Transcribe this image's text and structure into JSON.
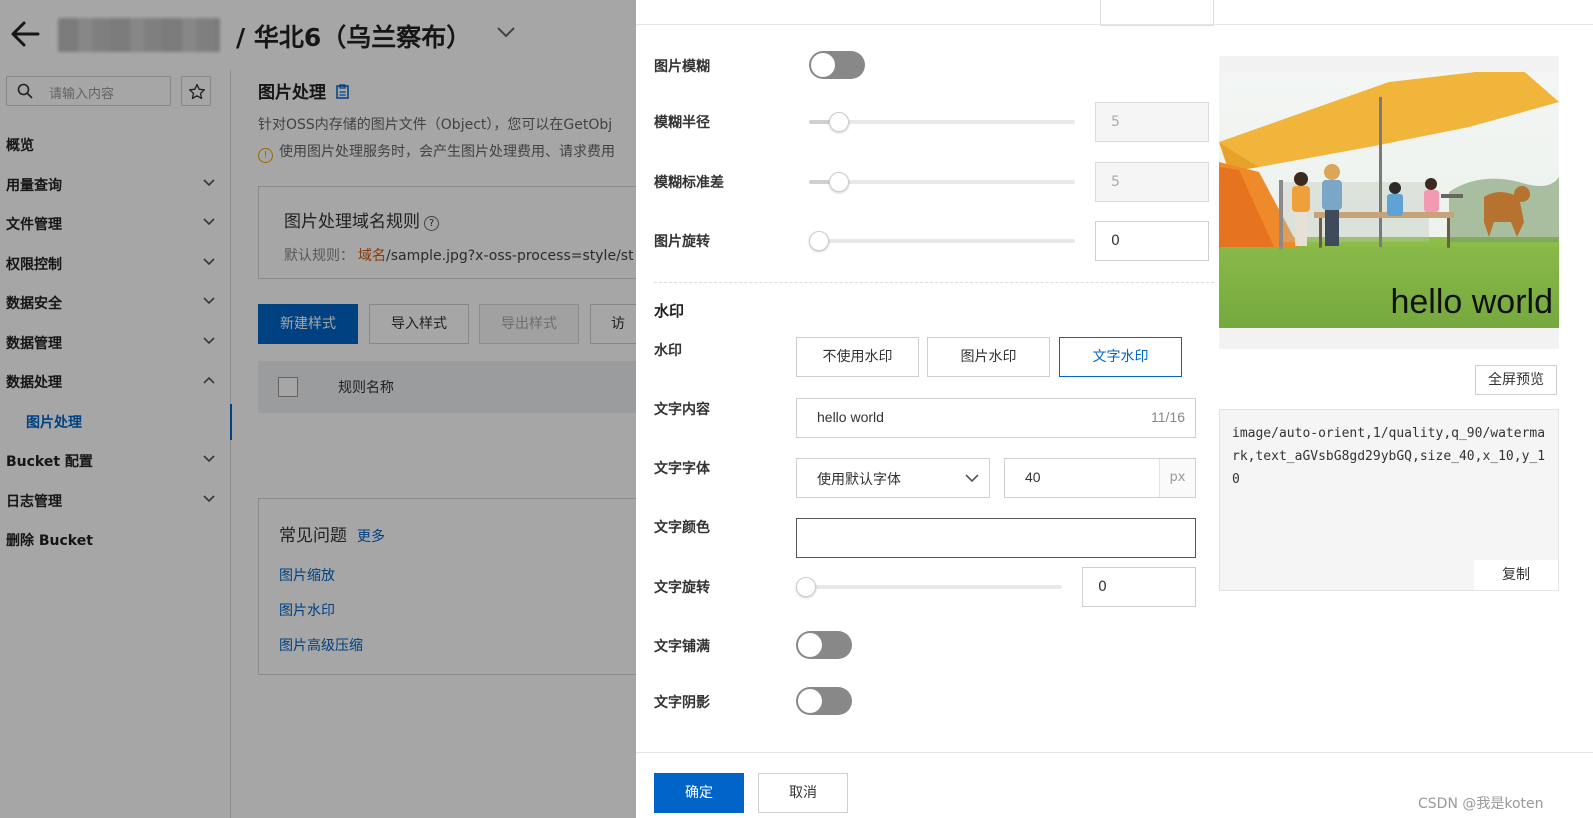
{
  "header": {
    "region_title": "/ 华北6（乌兰察布）"
  },
  "sidebar": {
    "search_placeholder": "请输入内容",
    "items": [
      {
        "label": "概览",
        "chevron": "none"
      },
      {
        "label": "用量查询",
        "chevron": "down"
      },
      {
        "label": "文件管理",
        "chevron": "down"
      },
      {
        "label": "权限控制",
        "chevron": "down"
      },
      {
        "label": "数据安全",
        "chevron": "down"
      },
      {
        "label": "数据管理",
        "chevron": "down"
      },
      {
        "label": "数据处理",
        "chevron": "up"
      },
      {
        "label": "图片处理",
        "chevron": "none",
        "sub": true,
        "active": true
      },
      {
        "label": "Bucket 配置",
        "chevron": "down"
      },
      {
        "label": "日志管理",
        "chevron": "down"
      },
      {
        "label": "删除 Bucket",
        "chevron": "none"
      }
    ]
  },
  "main": {
    "title": "图片处理",
    "description": "针对OSS内存储的图片文件（Object），您可以在GetObj",
    "warning": "使用图片处理服务时，会产生图片处理费用、请求费用",
    "rule_card": {
      "title": "图片处理域名规则",
      "rule_prefix": "默认规则：",
      "rule_domain": "域名",
      "rule_path": "/sample.jpg?x-oss-process=style/st"
    },
    "buttons": {
      "new_style": "新建样式",
      "import_style": "导入样式",
      "export_style": "导出样式",
      "access": "访"
    },
    "table": {
      "column_name": "规则名称"
    },
    "faq": {
      "title": "常见问题",
      "more": "更多",
      "links": [
        "图片缩放",
        "图片水印",
        "图片高级压缩"
      ]
    }
  },
  "drawer": {
    "blur": {
      "label": "图片模糊",
      "enabled": false
    },
    "blur_radius": {
      "label": "模糊半径",
      "value": "5",
      "min": 1,
      "max": 50,
      "level": 5
    },
    "blur_sigma": {
      "label": "模糊标准差",
      "value": "5",
      "min": 1,
      "max": 50,
      "level": 5
    },
    "rotate": {
      "label": "图片旋转",
      "value": "0",
      "min": 0,
      "max": 360,
      "level": 0
    },
    "watermark_section": "水印",
    "watermark": {
      "label": "水印",
      "options": [
        "不使用水印",
        "图片水印",
        "文字水印"
      ],
      "selected": "文字水印"
    },
    "text_content": {
      "label": "文字内容",
      "value": "hello world",
      "counter": "11/16"
    },
    "text_font": {
      "label": "文字字体",
      "font": "使用默认字体",
      "size": "40",
      "unit": "px"
    },
    "text_color": {
      "label": "文字颜色",
      "value": ""
    },
    "text_rotate": {
      "label": "文字旋转",
      "value": "0",
      "min": 0,
      "max": 360,
      "level": 0
    },
    "text_tile": {
      "label": "文字铺满",
      "enabled": false
    },
    "text_shadow": {
      "label": "文字阴影",
      "enabled": false
    },
    "preview": {
      "watermark_text": "hello world",
      "fullscreen_label": "全屏预览"
    },
    "code": {
      "value": "image/auto-orient,1/quality,q_90/watermark,text_aGVsbG8gd29ybGQ,size_40,x_10,y_10",
      "copy_label": "复制"
    },
    "footer": {
      "ok": "确定",
      "cancel": "取消",
      "credit": "CSDN @我是koten"
    }
  },
  "colors": {
    "primary": "#0064c8",
    "toggle_off": "#888888",
    "overlay": "rgba(0,0,0,0.35)"
  }
}
